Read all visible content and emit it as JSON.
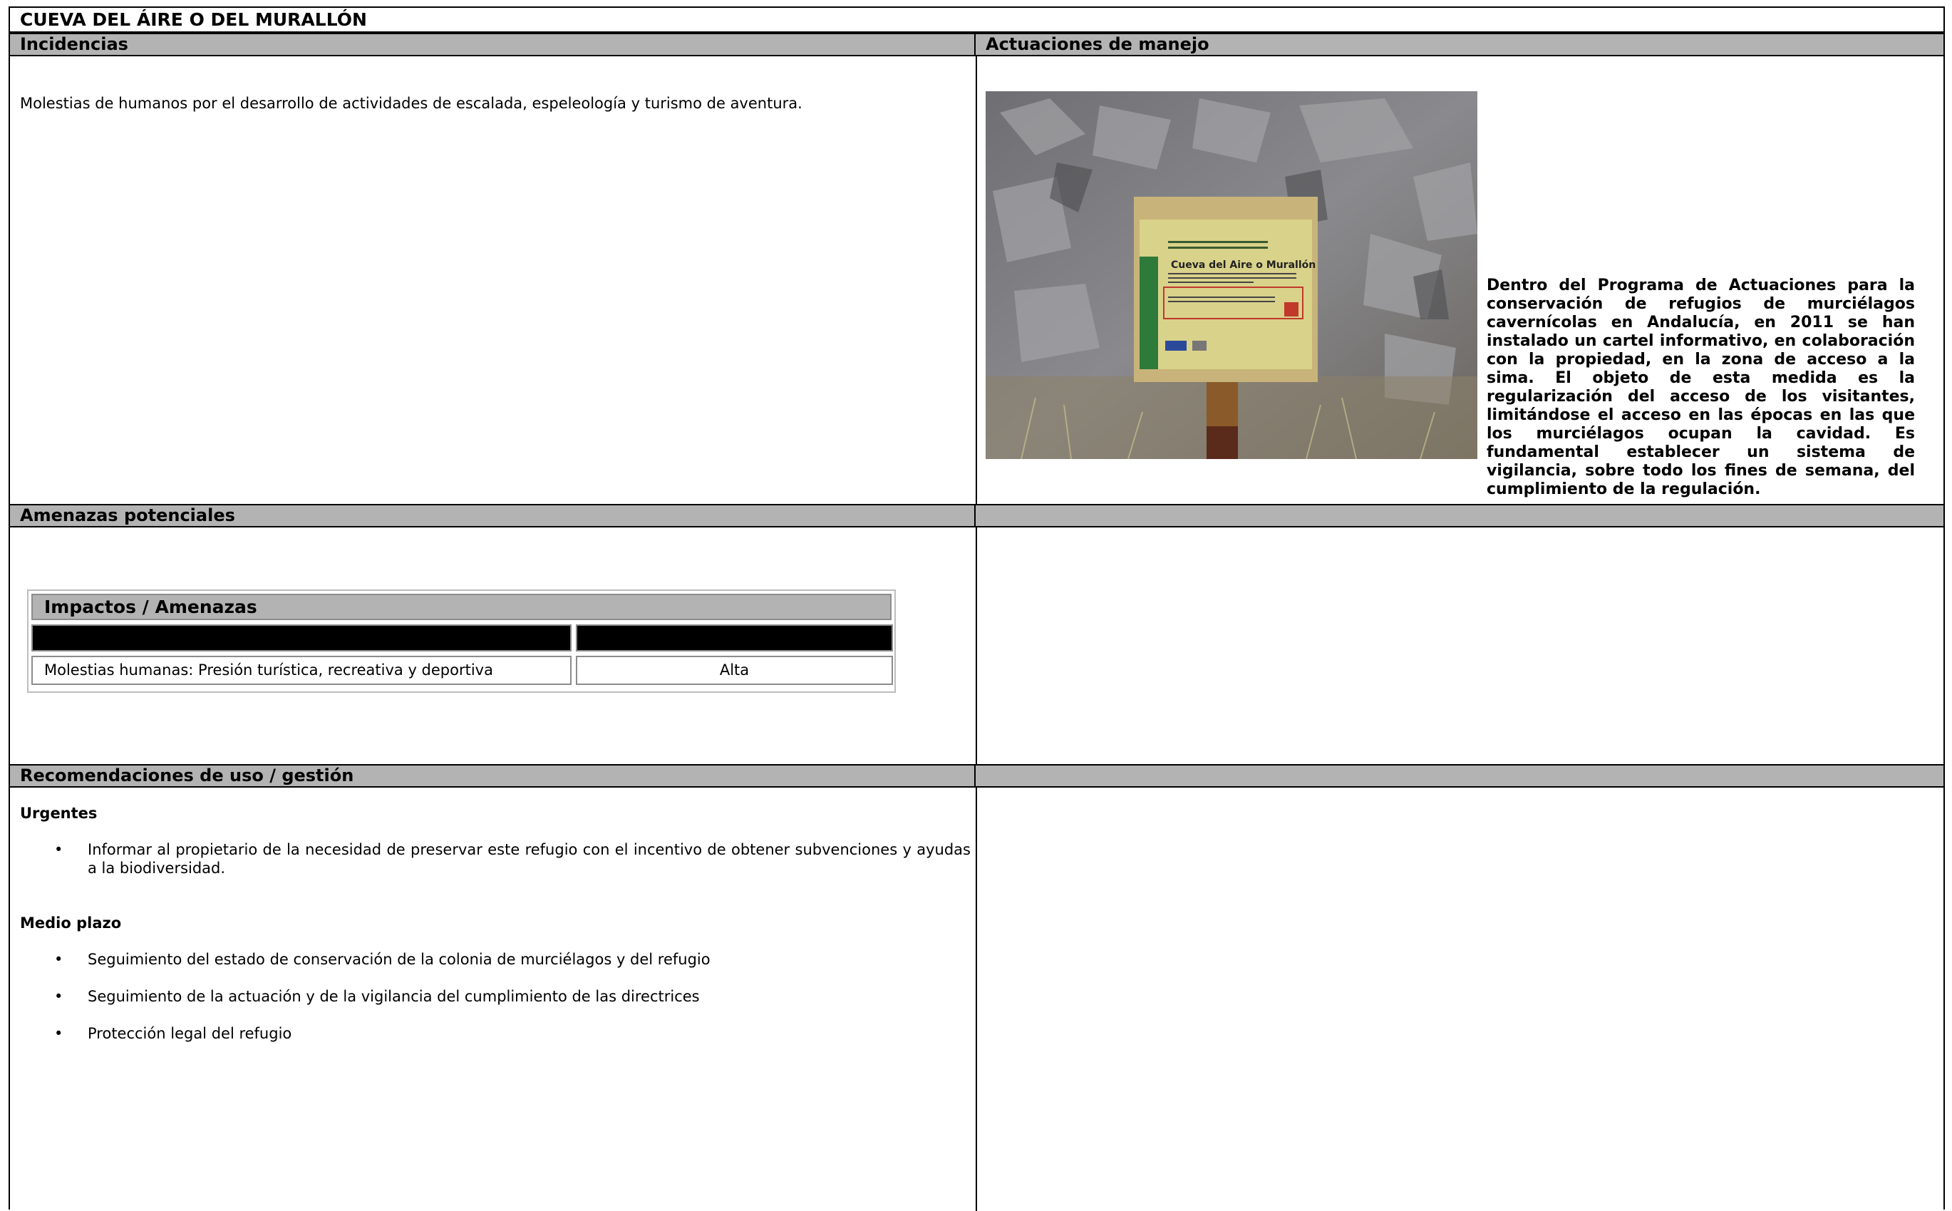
{
  "title": "CUEVA DEL ÁIRE O DEL MURALLÓN",
  "bars": {
    "incidencias": "Incidencias",
    "actuaciones": "Actuaciones de manejo",
    "amenazas": "Amenazas potenciales",
    "recomendaciones": "Recomendaciones de uso / gestión"
  },
  "incidencias_text": "Molestias de humanos por el desarrollo de actividades de escalada, espeleología y turismo de aventura.",
  "actuaciones_text": "Dentro del Programa de Actuaciones para la conservación de refugios de murciélagos cavernícolas en Andalucía, en 2011 se han instalado un cartel informativo, en colaboración con la propiedad, en la zona de acceso a la sima. El objeto de esta medida es la regularización del acceso de los visitantes, limitándose el acceso en las épocas en las que los murciélagos ocupan la cavidad. Es fundamental establecer un sistema de vigilancia, sobre todo los fines de semana, del cumplimiento de la regulación.",
  "photo": {
    "sign_title": "Cueva del Aire o Murallón",
    "icon": "photo-sign-on-rock"
  },
  "impactos": {
    "heading": "Impactos / Amenazas",
    "rows": [
      {
        "impacto": "Molestias humanas: Presión turística, recreativa y deportiva",
        "nivel": "Alta"
      }
    ]
  },
  "recomendaciones": {
    "urgentes_label": "Urgentes",
    "urgentes": [
      "Informar al propietario de la necesidad de preservar este refugio con el incentivo de obtener subvenciones y ayudas a la biodiversidad."
    ],
    "medio_label": "Medio plazo",
    "medio": [
      "Seguimiento del estado de conservación de la colonia de murciélagos y del refugio",
      "Seguimiento de la actuación y de la vigilancia del cumplimiento de las directrices",
      "Protección legal del refugio"
    ],
    "bullet": "•"
  },
  "colors": {
    "bar_gray": "#b3b3b3",
    "border": "#000000",
    "sign_yellow": "#d9d28a"
  }
}
